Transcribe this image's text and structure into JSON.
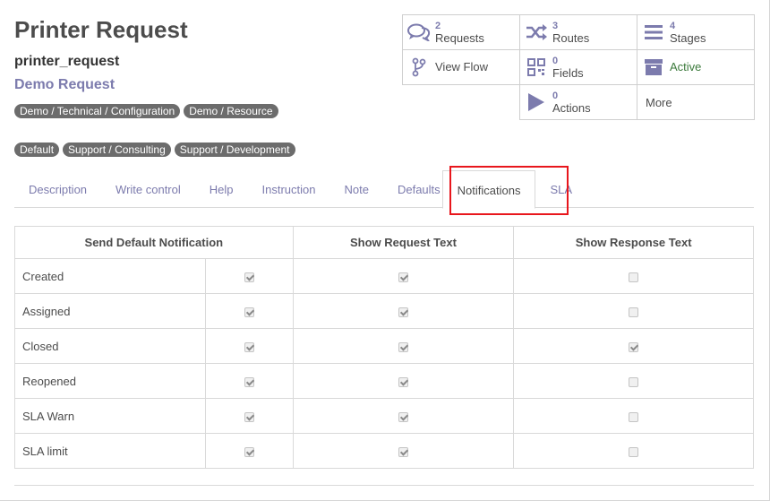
{
  "header": {
    "title": "Printer Request",
    "tech_name": "printer_request",
    "category": "Demo Request",
    "tags_row1": [
      "Demo / Technical / Configuration",
      "Demo / Resource"
    ],
    "tags_row2": [
      "Default",
      "Support / Consulting",
      "Support / Development"
    ]
  },
  "stats": {
    "requests": {
      "count": "2",
      "label": "Requests",
      "icon": "comments-icon"
    },
    "routes": {
      "count": "3",
      "label": "Routes",
      "icon": "shuffle-icon"
    },
    "stages": {
      "count": "4",
      "label": "Stages",
      "icon": "list-icon"
    },
    "view_flow": {
      "label": "View Flow",
      "icon": "flow-icon"
    },
    "fields": {
      "count": "0",
      "label": "Fields",
      "icon": "qrcode-icon"
    },
    "active": {
      "label": "Active",
      "icon": "archive-icon"
    },
    "actions": {
      "count": "0",
      "label": "Actions",
      "icon": "play-icon"
    },
    "more": {
      "label": "More"
    }
  },
  "tabs": [
    "Description",
    "Write control",
    "Help",
    "Instruction",
    "Note",
    "Defaults",
    "Notifications",
    "SLA"
  ],
  "active_tab": "Notifications",
  "table": {
    "headers": [
      "Send Default Notification",
      "Show Request Text",
      "Show Response Text"
    ],
    "rows": [
      {
        "name": "Created",
        "default": true,
        "request": true,
        "response": false
      },
      {
        "name": "Assigned",
        "default": true,
        "request": true,
        "response": false
      },
      {
        "name": "Closed",
        "default": true,
        "request": true,
        "response": true
      },
      {
        "name": "Reopened",
        "default": true,
        "request": true,
        "response": false
      },
      {
        "name": "SLA Warn",
        "default": true,
        "request": true,
        "response": false
      },
      {
        "name": "SLA limit",
        "default": true,
        "request": true,
        "response": false
      }
    ]
  },
  "colors": {
    "accent": "#7c7bad",
    "tag_bg": "#6c6c6c",
    "active_green": "#3c7a3c",
    "highlight": "#e8161c"
  }
}
